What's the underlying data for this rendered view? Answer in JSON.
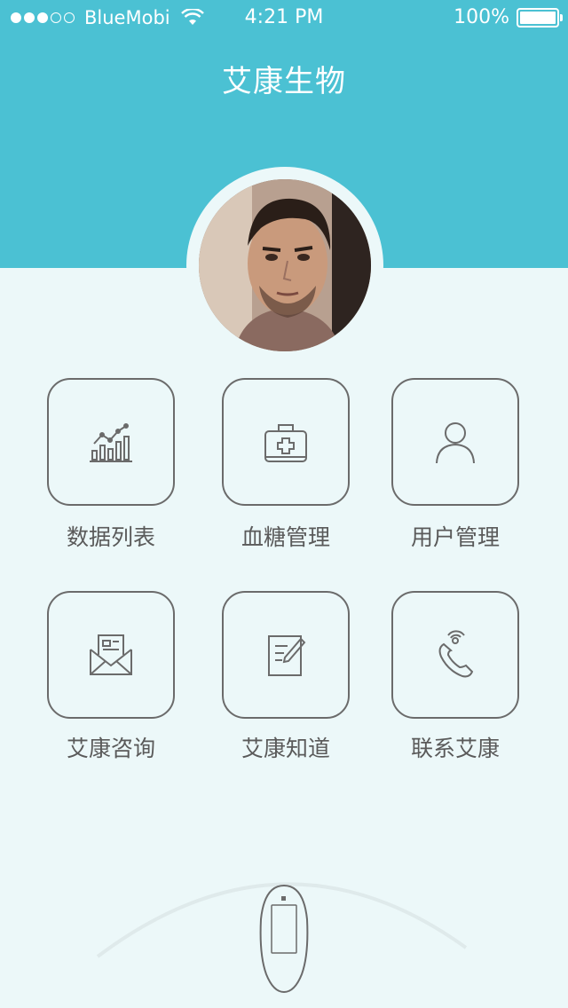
{
  "status_bar": {
    "carrier": "BlueMobi",
    "time": "4:21 PM",
    "battery": "100%"
  },
  "header": {
    "title": "艾康生物"
  },
  "menu": [
    {
      "label": "数据列表",
      "icon": "bar-chart-icon"
    },
    {
      "label": "血糖管理",
      "icon": "medical-kit-icon"
    },
    {
      "label": "用户管理",
      "icon": "user-icon"
    },
    {
      "label": "艾康咨询",
      "icon": "mail-envelope-icon"
    },
    {
      "label": "艾康知道",
      "icon": "notepad-pen-icon"
    },
    {
      "label": "联系艾康",
      "icon": "phone-icon"
    }
  ],
  "colors": {
    "header_bg": "#4bc1d3",
    "page_bg": "#ecf8f9",
    "icon_stroke": "#6b6b6b"
  }
}
